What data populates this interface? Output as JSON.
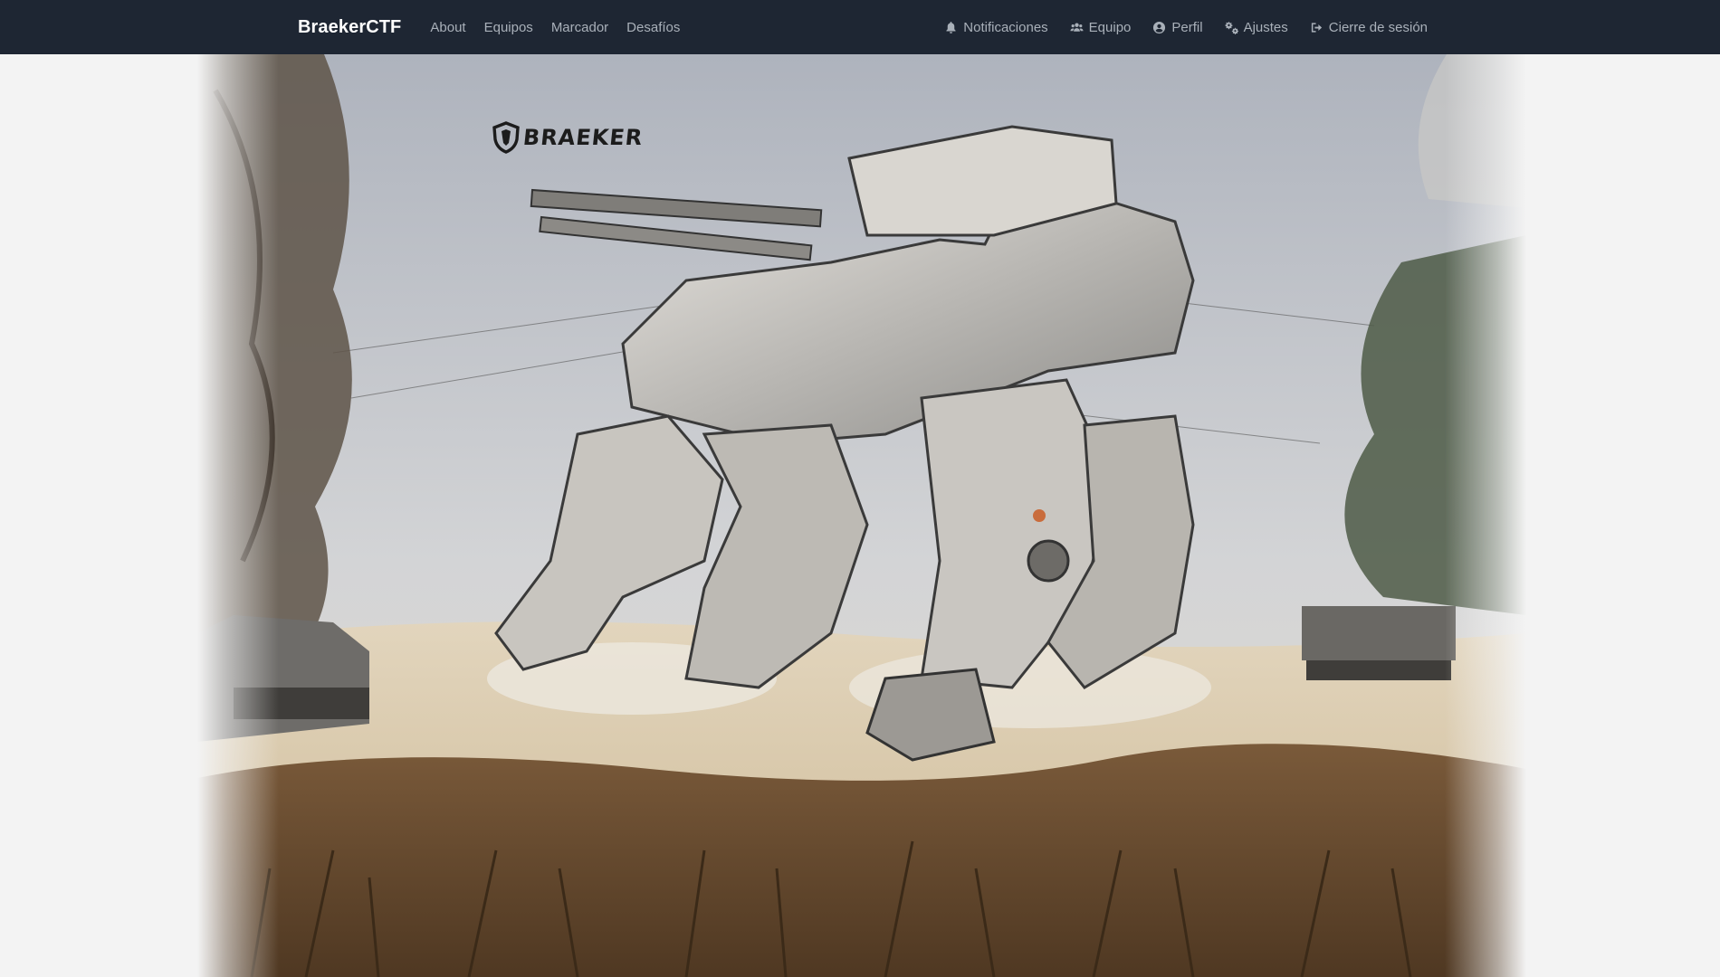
{
  "navbar": {
    "brand": "BraekerCTF",
    "left_links": [
      {
        "label": "About"
      },
      {
        "label": "Equipos"
      },
      {
        "label": "Marcador"
      },
      {
        "label": "Desafíos"
      }
    ],
    "right_links": [
      {
        "label": "Notificaciones",
        "icon": "bell-icon"
      },
      {
        "label": "Equipo",
        "icon": "users-icon"
      },
      {
        "label": "Perfil",
        "icon": "user-circle-icon"
      },
      {
        "label": "Ajustes",
        "icon": "cogs-icon"
      },
      {
        "label": "Cierre de sesión",
        "icon": "sign-out-icon"
      }
    ]
  },
  "hero": {
    "logo_text": "BRAEKER",
    "image": "mech-battlefield-illustration"
  },
  "colors": {
    "navbar_bg": "#1e2633",
    "brand_text": "#ffffff",
    "nav_link_text": "#a9b0b9",
    "page_bg": "#f3f3f3"
  }
}
